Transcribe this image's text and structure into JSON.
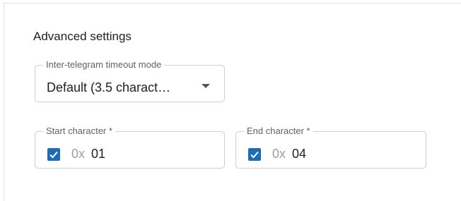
{
  "advanced": {
    "title": "Advanced settings",
    "timeout_mode": {
      "label": "Inter-telegram timeout mode",
      "value": "Default (3.5 charact…",
      "icon": "chevron-down-icon"
    },
    "start_character": {
      "label": "Start character *",
      "checked": true,
      "prefix": "0x",
      "value": "01"
    },
    "end_character": {
      "label": "End character *",
      "checked": true,
      "prefix": "0x",
      "value": "04"
    }
  },
  "colors": {
    "accent": "#1f6cb6",
    "border": "#cfcfcf",
    "label": "#616161",
    "text": "#212121",
    "prefix": "#9e9e9e"
  }
}
